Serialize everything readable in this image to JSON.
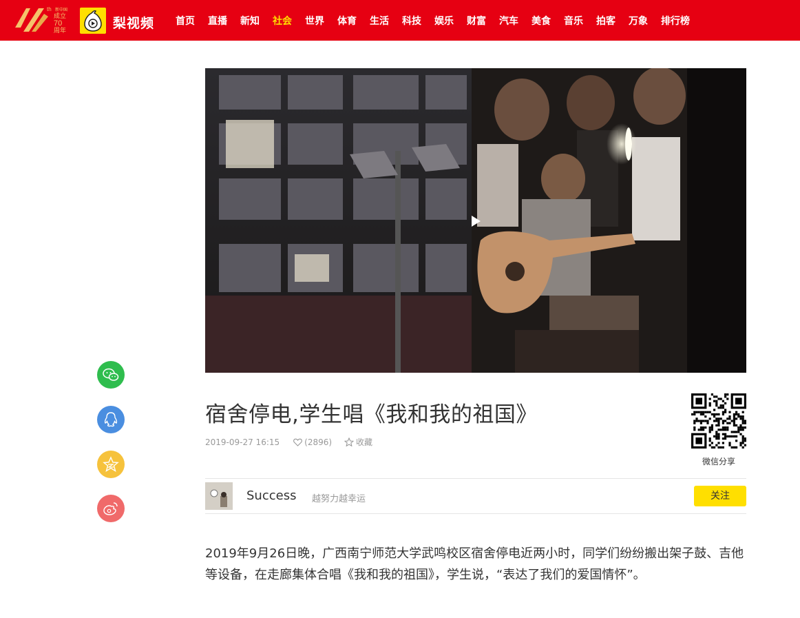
{
  "header": {
    "logo70": {
      "th": "th",
      "years": "70",
      "line1": "新中国",
      "line2": "成立",
      "line3": "周年"
    },
    "brand": "梨视频",
    "nav": [
      {
        "label": "首页",
        "active": false
      },
      {
        "label": "直播",
        "active": false
      },
      {
        "label": "新知",
        "active": false
      },
      {
        "label": "社会",
        "active": true
      },
      {
        "label": "世界",
        "active": false
      },
      {
        "label": "体育",
        "active": false
      },
      {
        "label": "生活",
        "active": false
      },
      {
        "label": "科技",
        "active": false
      },
      {
        "label": "娱乐",
        "active": false
      },
      {
        "label": "财富",
        "active": false
      },
      {
        "label": "汽车",
        "active": false
      },
      {
        "label": "美食",
        "active": false
      },
      {
        "label": "音乐",
        "active": false
      },
      {
        "label": "拍客",
        "active": false
      },
      {
        "label": "万象",
        "active": false
      },
      {
        "label": "排行榜",
        "active": false
      }
    ]
  },
  "share": [
    "wechat-icon",
    "qq-icon",
    "qzone-icon",
    "weibo-icon"
  ],
  "video": {
    "play_icon": "play-icon"
  },
  "article": {
    "title": "宿舍停电,学生唱《我和我的祖国》",
    "date": "2019-09-27 16:15",
    "likes": "(2896)",
    "favorite_label": "收藏",
    "qr_label": "微信分享"
  },
  "author": {
    "name": "Success",
    "signature": "越努力越幸运",
    "follow_label": "关注"
  },
  "description": "2019年9月26日晚，广西南宁师范大学武鸣校区宿舍停电近两小时，同学们纷纷搬出架子鼓、吉他等设备，在走廊集体合唱《我和我的祖国》，学生说，“表达了我们的爱国情怀”。",
  "colors": {
    "brand_red": "#e60012",
    "accent_yellow": "#ffdf00"
  }
}
